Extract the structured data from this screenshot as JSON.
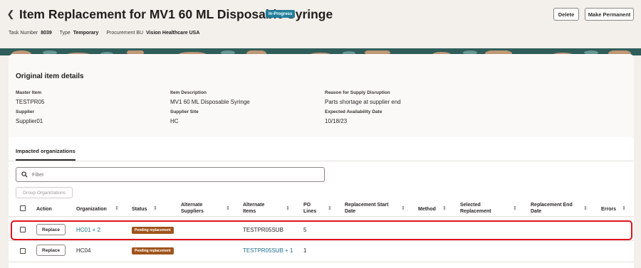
{
  "header": {
    "title": "Item Replacement for MV1 60 ML Disposable Syringe",
    "status": "In-Progress",
    "delete_label": "Delete",
    "make_permanent_label": "Make Permanent",
    "meta": {
      "task_number_label": "Task Number",
      "task_number": "8039",
      "type_label": "Type",
      "type": "Temporary",
      "procurement_bu_label": "Procurement BU",
      "procurement_bu": "Vision Healthcare USA"
    }
  },
  "original": {
    "title": "Original item details",
    "master_item_label": "Master Item",
    "master_item": "TESTPR05",
    "item_description_label": "Item Description",
    "item_description": "MV1 60 ML Disposable Syringe",
    "reason_label": "Reason for Supply Disruption",
    "reason": "Parts shortage at supplier end",
    "supplier_label": "Supplier",
    "supplier": "Supplier01",
    "supplier_site_label": "Supplier Site",
    "supplier_site": "HC",
    "expected_date_label": "Expected Availability Date",
    "expected_date": "10/18/23"
  },
  "impacted": {
    "tab_label": "Impacted organizations",
    "filter_placeholder": "Filter",
    "group_button_label": "Group Organizations",
    "columns": {
      "action": "Action",
      "organization": "Organization",
      "status": "Status",
      "alternate_suppliers_1": "Alternate",
      "alternate_suppliers_2": "Suppliers",
      "alternate_items_1": "Alternate",
      "alternate_items_2": "Items",
      "po_lines_1": "PO",
      "po_lines_2": "Lines",
      "start_date_1": "Replacement Start",
      "start_date_2": "Date",
      "method": "Method",
      "selected_1": "Selected",
      "selected_2": "Replacement",
      "end_date_1": "Replacement End",
      "end_date_2": "Date",
      "errors": "Errors"
    },
    "rows": [
      {
        "action": "Replace",
        "organization": "HC01 + 2",
        "status": "Pending replacement",
        "alternate_items": "TESTPR05SUB",
        "po_lines": "5"
      },
      {
        "action": "Replace",
        "organization": "HC04",
        "status": "Pending replacement",
        "alternate_items": "TESTPR05SUB + 1",
        "po_lines": "1"
      }
    ]
  },
  "colors": {
    "status_in_progress": "#237e9b",
    "status_pending": "#a0541c",
    "link": "#1d6e8d",
    "highlight": "#e0141c"
  }
}
